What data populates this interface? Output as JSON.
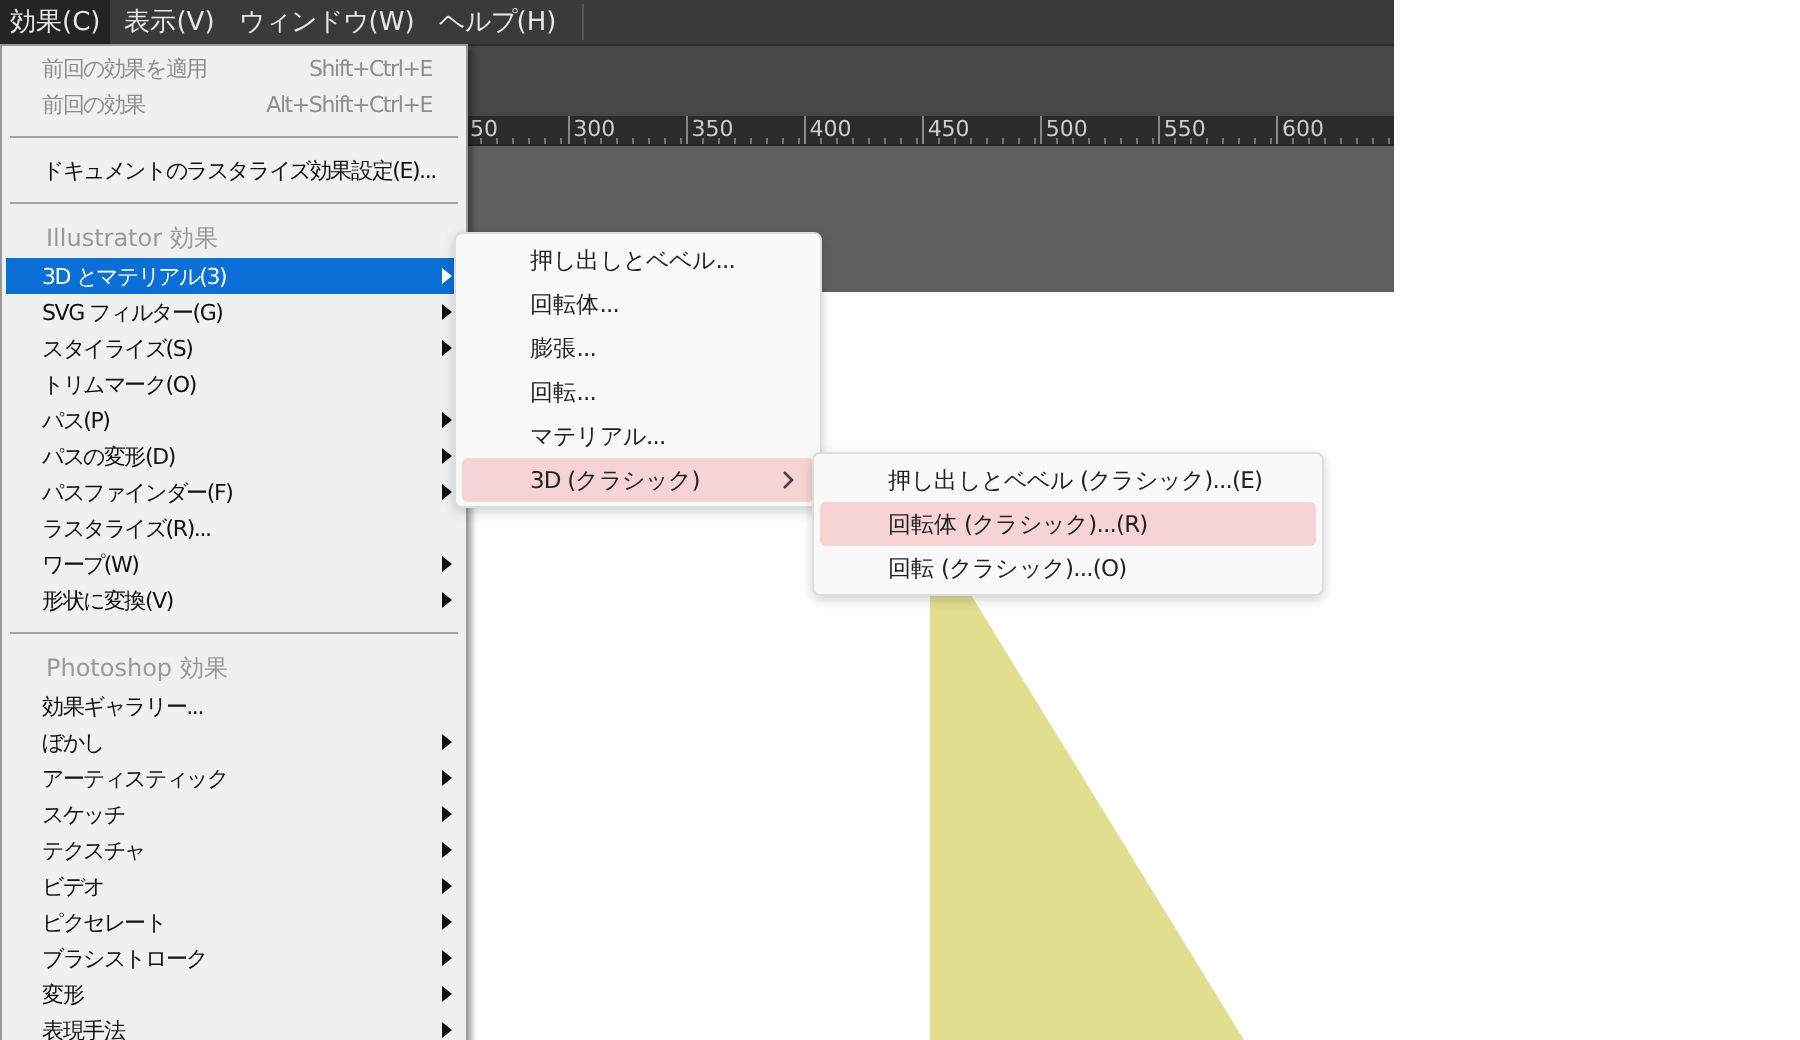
{
  "menubar": [
    {
      "label": "効果(C)",
      "selected": true
    },
    {
      "label": "表示(V)",
      "selected": false
    },
    {
      "label": "ウィンドウ(W)",
      "selected": false
    },
    {
      "label": "ヘルプ(H)",
      "selected": false
    }
  ],
  "ruler": [
    "50",
    "300",
    "350",
    "400",
    "450",
    "500",
    "550",
    "600"
  ],
  "menu": [
    {
      "kind": "item",
      "label": "前回の効果を適用",
      "shortcut": "Shift+Ctrl+E",
      "disabled": true,
      "submenu": false,
      "selected": false
    },
    {
      "kind": "item",
      "label": "前回の効果",
      "shortcut": "Alt+Shift+Ctrl+E",
      "disabled": true,
      "submenu": false,
      "selected": false
    },
    {
      "kind": "separator"
    },
    {
      "kind": "item",
      "label": "ドキュメントのラスタライズ効果設定(E)...",
      "disabled": false,
      "submenu": false,
      "selected": false
    },
    {
      "kind": "separator"
    },
    {
      "kind": "header",
      "label": "Illustrator 効果"
    },
    {
      "kind": "item",
      "label": "3D とマテリアル(3)",
      "disabled": false,
      "submenu": true,
      "selected": true
    },
    {
      "kind": "item",
      "label": "SVG フィルター(G)",
      "disabled": false,
      "submenu": true,
      "selected": false
    },
    {
      "kind": "item",
      "label": "スタイライズ(S)",
      "disabled": false,
      "submenu": true,
      "selected": false
    },
    {
      "kind": "item",
      "label": "トリムマーク(O)",
      "disabled": false,
      "submenu": false,
      "selected": false
    },
    {
      "kind": "item",
      "label": "パス(P)",
      "disabled": false,
      "submenu": true,
      "selected": false
    },
    {
      "kind": "item",
      "label": "パスの変形(D)",
      "disabled": false,
      "submenu": true,
      "selected": false
    },
    {
      "kind": "item",
      "label": "パスファインダー(F)",
      "disabled": false,
      "submenu": true,
      "selected": false
    },
    {
      "kind": "item",
      "label": "ラスタライズ(R)...",
      "disabled": false,
      "submenu": false,
      "selected": false
    },
    {
      "kind": "item",
      "label": "ワープ(W)",
      "disabled": false,
      "submenu": true,
      "selected": false
    },
    {
      "kind": "item",
      "label": "形状に変換(V)",
      "disabled": false,
      "submenu": true,
      "selected": false
    },
    {
      "kind": "separator"
    },
    {
      "kind": "header",
      "label": "Photoshop 効果"
    },
    {
      "kind": "item",
      "label": "効果ギャラリー...",
      "disabled": false,
      "submenu": false,
      "selected": false
    },
    {
      "kind": "item",
      "label": "ぼかし",
      "disabled": false,
      "submenu": true,
      "selected": false
    },
    {
      "kind": "item",
      "label": "アーティスティック",
      "disabled": false,
      "submenu": true,
      "selected": false
    },
    {
      "kind": "item",
      "label": "スケッチ",
      "disabled": false,
      "submenu": true,
      "selected": false
    },
    {
      "kind": "item",
      "label": "テクスチャ",
      "disabled": false,
      "submenu": true,
      "selected": false
    },
    {
      "kind": "item",
      "label": "ビデオ",
      "disabled": false,
      "submenu": true,
      "selected": false
    },
    {
      "kind": "item",
      "label": "ピクセレート",
      "disabled": false,
      "submenu": true,
      "selected": false
    },
    {
      "kind": "item",
      "label": "ブラシストローク",
      "disabled": false,
      "submenu": true,
      "selected": false
    },
    {
      "kind": "item",
      "label": "変形",
      "disabled": false,
      "submenu": true,
      "selected": false
    },
    {
      "kind": "item",
      "label": "表現手法",
      "disabled": false,
      "submenu": true,
      "selected": false
    }
  ],
  "submenu_3d": [
    {
      "label": "押し出しとベベル...",
      "submenu": false,
      "selected": false
    },
    {
      "label": "回転体...",
      "submenu": false,
      "selected": false
    },
    {
      "label": "膨張...",
      "submenu": false,
      "selected": false
    },
    {
      "label": "回転...",
      "submenu": false,
      "selected": false
    },
    {
      "label": "マテリアル...",
      "submenu": false,
      "selected": false
    },
    {
      "label": "3D (クラシック)",
      "submenu": true,
      "selected": true
    }
  ],
  "submenu_classic": [
    {
      "label": "押し出しとベベル (クラシック)...(E)",
      "selected": false
    },
    {
      "label": "回転体 (クラシック)...(R)",
      "selected": true
    },
    {
      "label": "回転 (クラシック)...(O)",
      "selected": false
    }
  ]
}
